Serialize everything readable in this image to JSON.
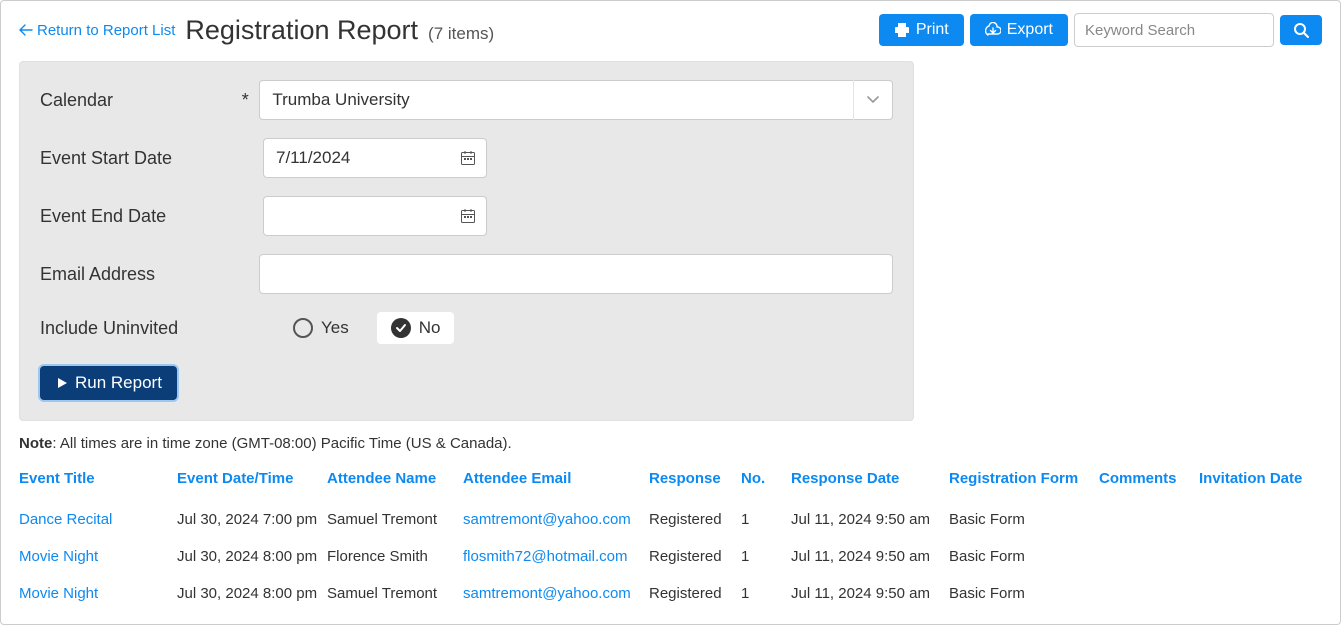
{
  "header": {
    "back_label": "Return to Report List",
    "title": "Registration Report",
    "count_label": "(7 items)",
    "print_label": "Print",
    "export_label": "Export",
    "search_placeholder": "Keyword Search"
  },
  "filters": {
    "calendar_label": "Calendar",
    "calendar_value": "Trumba University",
    "start_label": "Event Start Date",
    "start_value": "7/11/2024",
    "end_label": "Event End Date",
    "end_value": "",
    "email_label": "Email Address",
    "email_value": "",
    "uninvited_label": "Include Uninvited",
    "uninvited_yes": "Yes",
    "uninvited_no": "No",
    "run_label": "Run Report"
  },
  "note": {
    "prefix": "Note",
    "text": ": All times are in time zone (GMT-08:00) Pacific Time (US & Canada)."
  },
  "table": {
    "columns": {
      "event_title": "Event Title",
      "event_date": "Event Date/Time",
      "attendee_name": "Attendee Name",
      "attendee_email": "Attendee Email",
      "response": "Response",
      "no": "No.",
      "response_date": "Response Date",
      "reg_form": "Registration Form",
      "comments": "Comments",
      "invitation_date": "Invitation Date"
    },
    "rows": [
      {
        "event_title": "Dance Recital",
        "event_date": "Jul 30, 2024 7:00 pm",
        "attendee_name": "Samuel Tremont",
        "attendee_email": "samtremont@yahoo.com",
        "response": "Registered",
        "no": "1",
        "response_date": "Jul 11, 2024 9:50 am",
        "reg_form": "Basic Form",
        "comments": "",
        "invitation_date": ""
      },
      {
        "event_title": "Movie Night",
        "event_date": "Jul 30, 2024 8:00 pm",
        "attendee_name": "Florence Smith",
        "attendee_email": "flosmith72@hotmail.com",
        "response": "Registered",
        "no": "1",
        "response_date": "Jul 11, 2024 9:50 am",
        "reg_form": "Basic Form",
        "comments": "",
        "invitation_date": ""
      },
      {
        "event_title": "Movie Night",
        "event_date": "Jul 30, 2024 8:00 pm",
        "attendee_name": "Samuel Tremont",
        "attendee_email": "samtremont@yahoo.com",
        "response": "Registered",
        "no": "1",
        "response_date": "Jul 11, 2024 9:50 am",
        "reg_form": "Basic Form",
        "comments": "",
        "invitation_date": ""
      }
    ]
  }
}
